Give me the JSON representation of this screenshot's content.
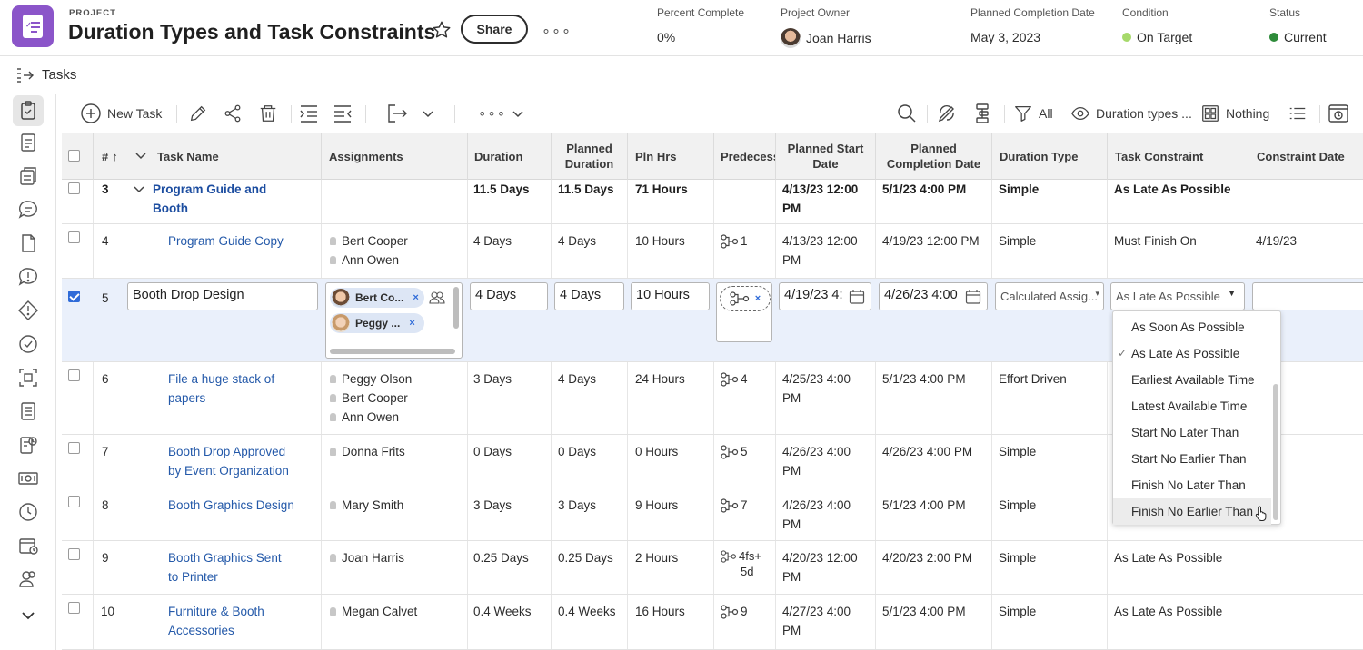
{
  "header": {
    "project_label": "PROJECT",
    "title": "Duration Types and Task Constraints",
    "share_label": "Share",
    "more_label": "∘∘∘",
    "meta": [
      {
        "key": "Percent Complete",
        "value": "0%"
      },
      {
        "key": "Project Owner",
        "value": "Joan Harris"
      },
      {
        "key": "Planned Completion Date",
        "value": "May 3, 2023"
      },
      {
        "key": "Condition",
        "value": "On Target",
        "color": "#a6d96a"
      },
      {
        "key": "Status",
        "value": "Current",
        "color": "#2e8b3a"
      }
    ]
  },
  "subbar": {
    "label": "Tasks"
  },
  "toolbar": {
    "new_task": "New Task",
    "more": "∘∘∘",
    "filter": "All",
    "view": "Duration types ...",
    "grouping": "Nothing"
  },
  "columns": {
    "num": "#",
    "task_name": "Task Name",
    "assignments": "Assignments",
    "duration": "Duration",
    "planned_duration": "Planned Duration",
    "pln_hrs": "Pln Hrs",
    "predecessors": "Predecess",
    "planned_start": "Planned Start Date",
    "planned_completion": "Planned Completion Date",
    "duration_type": "Duration Type",
    "task_constraint": "Task Constraint",
    "constraint_date": "Constraint Date"
  },
  "rows": [
    {
      "num": "3",
      "name_1": "Program Guide and",
      "name_2": "Booth",
      "assign": [],
      "duration": "11.5 Days",
      "planned_duration": "11.5 Days",
      "pln_hrs": "71 Hours",
      "pred": "",
      "start_1": "4/13/23 12:00",
      "start_2": "PM",
      "completion": "5/1/23 4:00 PM",
      "duration_type": "Simple",
      "constraint": "As Late As Possible",
      "constraint_date": ""
    },
    {
      "num": "4",
      "name_1": "Program Guide Copy",
      "name_2": "",
      "assign": [
        "Bert Cooper",
        "Ann Owen"
      ],
      "duration": "4 Days",
      "planned_duration": "4 Days",
      "pln_hrs": "10 Hours",
      "pred": "1",
      "start_1": "4/13/23 12:00",
      "start_2": "PM",
      "completion": "4/19/23 12:00 PM",
      "duration_type": "Simple",
      "constraint": "Must Finish On",
      "constraint_date": "4/19/23"
    },
    {
      "num": "6",
      "name_1": "File a huge stack of",
      "name_2": "papers",
      "assign": [
        "Peggy Olson",
        "Bert Cooper",
        "Ann Owen"
      ],
      "duration": "3 Days",
      "planned_duration": "4 Days",
      "pln_hrs": "24 Hours",
      "pred": "4",
      "start_1": "4/25/23 4:00",
      "start_2": "PM",
      "completion": "5/1/23 4:00 PM",
      "duration_type": "Effort Driven",
      "constraint": "",
      "constraint_date": ""
    },
    {
      "num": "7",
      "name_1": "Booth Drop Approved",
      "name_2": "by Event Organization",
      "assign": [
        "Donna Frits"
      ],
      "duration": "0 Days",
      "planned_duration": "0 Days",
      "pln_hrs": "0 Hours",
      "pred": "5",
      "start_1": "4/26/23 4:00",
      "start_2": "PM",
      "completion": "4/26/23 4:00 PM",
      "duration_type": "Simple",
      "constraint": "",
      "constraint_date": ""
    },
    {
      "num": "8",
      "name_1": "Booth Graphics Design",
      "name_2": "",
      "assign": [
        "Mary Smith"
      ],
      "duration": "3 Days",
      "planned_duration": "3 Days",
      "pln_hrs": "9 Hours",
      "pred": "7",
      "start_1": "4/26/23 4:00",
      "start_2": "PM",
      "completion": "5/1/23 4:00 PM",
      "duration_type": "Simple",
      "constraint": "",
      "constraint_date": ""
    },
    {
      "num": "9",
      "name_1": "Booth Graphics Sent",
      "name_2": "to Printer",
      "assign": [
        "Joan Harris"
      ],
      "duration": "0.25 Days",
      "planned_duration": "0.25 Days",
      "pln_hrs": "2 Hours",
      "pred": "4fs+",
      "pred_2": "5d",
      "start_1": "4/20/23 12:00",
      "start_2": "PM",
      "completion": "4/20/23 2:00 PM",
      "duration_type": "Simple",
      "constraint": "As Late As Possible",
      "constraint_date": ""
    },
    {
      "num": "10",
      "name_1": "Furniture & Booth",
      "name_2": "Accessories",
      "assign": [
        "Megan Calvet"
      ],
      "duration": "0.4 Weeks",
      "planned_duration": "0.4 Weeks",
      "pln_hrs": "16 Hours",
      "pred": "9",
      "start_1": "4/27/23 4:00",
      "start_2": "PM",
      "completion": "5/1/23 4:00 PM",
      "duration_type": "Simple",
      "constraint": "As Late As Possible",
      "constraint_date": ""
    }
  ],
  "editing_row": {
    "num": "5",
    "name": "Booth Drop Design",
    "chips": [
      "Bert Co...",
      "Peggy ..."
    ],
    "duration": "4 Days",
    "planned_duration": "4 Days",
    "pln_hrs": "10 Hours",
    "start": "4/19/23 4:",
    "completion": "4/26/23 4:00",
    "duration_type": "Calculated Assig...",
    "constraint": "As Late As Possible",
    "constraint_date": ""
  },
  "constraint_menu": {
    "options": [
      "As Soon As Possible",
      "As Late As Possible",
      "Earliest Available Time",
      "Latest Available Time",
      "Start No Later Than",
      "Start No Earlier Than",
      "Finish No Later Than",
      "Finish No Earlier Than"
    ],
    "selected": "As Late As Possible",
    "hovered": "Finish No Earlier Than"
  }
}
